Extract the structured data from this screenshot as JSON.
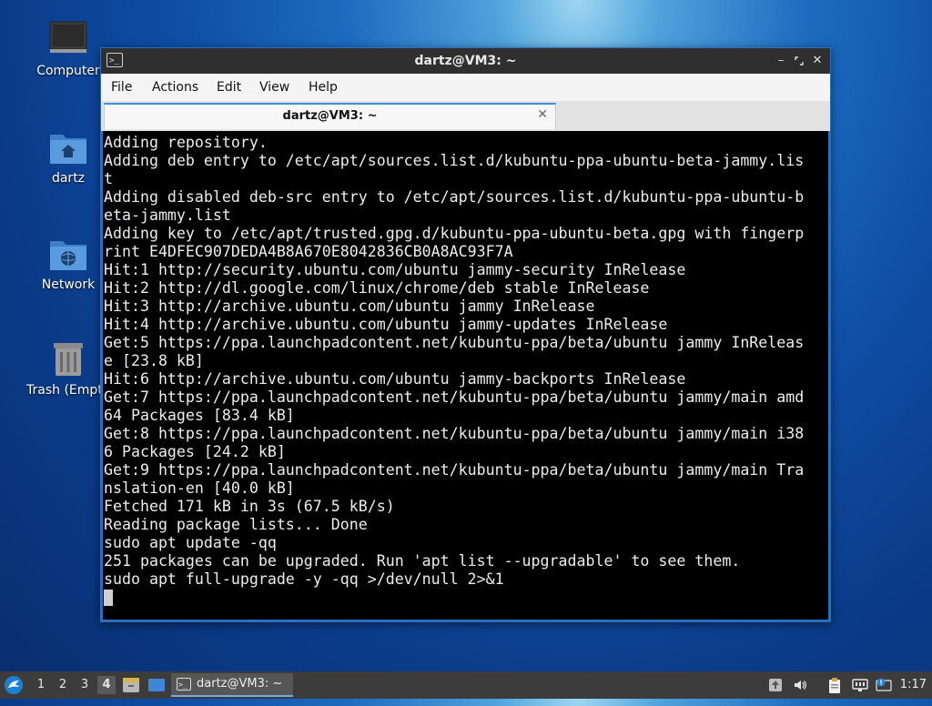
{
  "desktop": {
    "icons": [
      {
        "label": "Computer"
      },
      {
        "label": "dartz"
      },
      {
        "label": "Network"
      },
      {
        "label": "Trash (Empt"
      }
    ]
  },
  "window": {
    "title": "dartz@VM3: ~",
    "menu": [
      "File",
      "Actions",
      "Edit",
      "View",
      "Help"
    ],
    "tab_title": "dartz@VM3: ~",
    "terminal_lines": [
      "Adding repository.",
      "Adding deb entry to /etc/apt/sources.list.d/kubuntu-ppa-ubuntu-beta-jammy.lis",
      "t",
      "Adding disabled deb-src entry to /etc/apt/sources.list.d/kubuntu-ppa-ubuntu-b",
      "eta-jammy.list",
      "Adding key to /etc/apt/trusted.gpg.d/kubuntu-ppa-ubuntu-beta.gpg with fingerp",
      "rint E4DFEC907DEDA4B8A670E8042836CB0A8AC93F7A",
      "Hit:1 http://security.ubuntu.com/ubuntu jammy-security InRelease",
      "Hit:2 http://dl.google.com/linux/chrome/deb stable InRelease",
      "Hit:3 http://archive.ubuntu.com/ubuntu jammy InRelease",
      "Hit:4 http://archive.ubuntu.com/ubuntu jammy-updates InRelease",
      "Get:5 https://ppa.launchpadcontent.net/kubuntu-ppa/beta/ubuntu jammy InReleas",
      "e [23.8 kB]",
      "Hit:6 http://archive.ubuntu.com/ubuntu jammy-backports InRelease",
      "Get:7 https://ppa.launchpadcontent.net/kubuntu-ppa/beta/ubuntu jammy/main amd",
      "64 Packages [83.4 kB]",
      "Get:8 https://ppa.launchpadcontent.net/kubuntu-ppa/beta/ubuntu jammy/main i38",
      "6 Packages [24.2 kB]",
      "Get:9 https://ppa.launchpadcontent.net/kubuntu-ppa/beta/ubuntu jammy/main Tra",
      "nslation-en [40.0 kB]",
      "Fetched 171 kB in 3s (67.5 kB/s)",
      "Reading package lists... Done",
      "sudo apt update -qq",
      "251 packages can be upgraded. Run 'apt list --upgradable' to see them.",
      "sudo apt full-upgrade -y -qq >/dev/null 2>&1"
    ]
  },
  "taskbar": {
    "workspaces": [
      "1",
      "2",
      "3",
      "4"
    ],
    "active_workspace": "4",
    "task_label": "dartz@VM3: ~",
    "clock": "1:17"
  },
  "colors": {
    "accent": "#3b8ee0",
    "terminal_bg": "#000000",
    "terminal_fg": "#ececec"
  }
}
